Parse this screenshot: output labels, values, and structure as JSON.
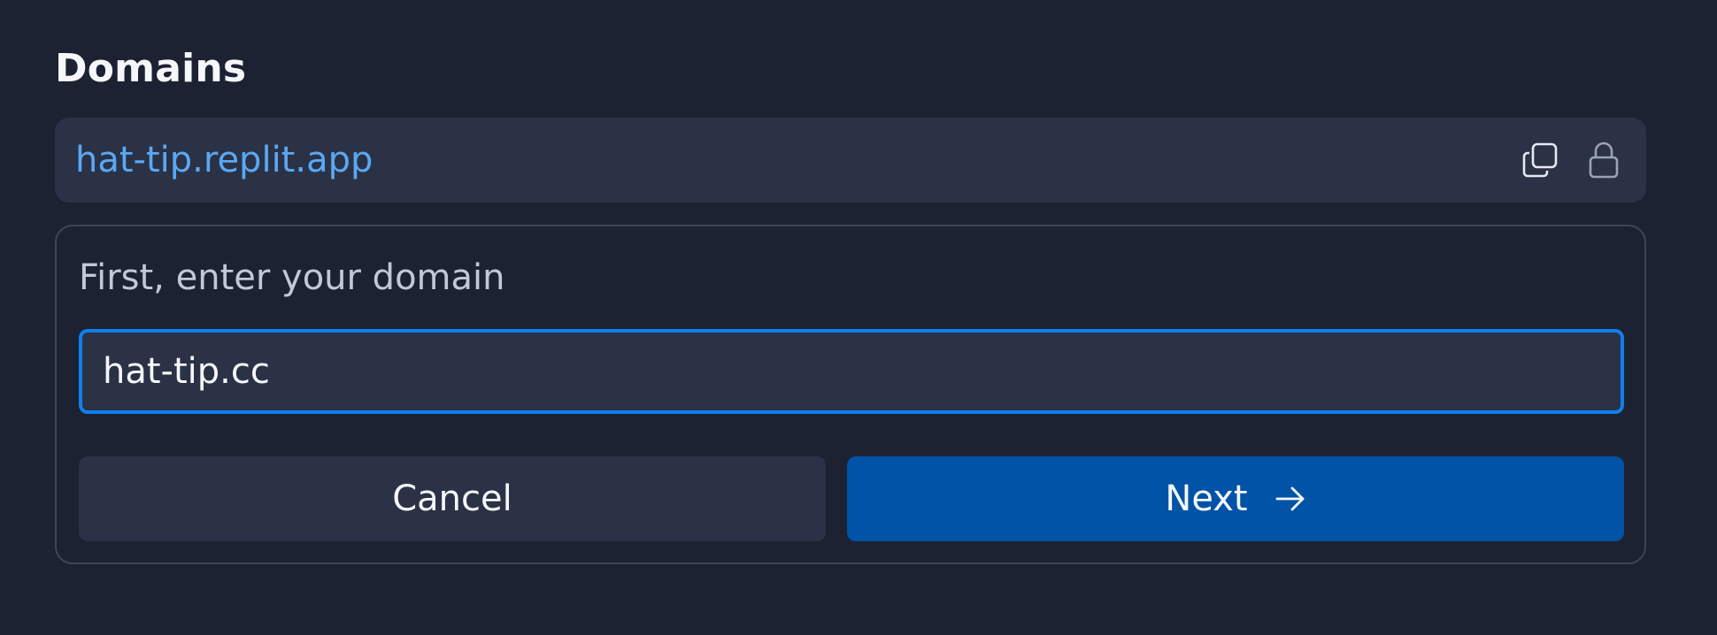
{
  "section": {
    "title": "Domains"
  },
  "current_domain": {
    "url": "hat-tip.replit.app",
    "icons": [
      "copy-icon",
      "lock-icon"
    ]
  },
  "form": {
    "label": "First, enter your domain",
    "input_value": "hat-tip.cc",
    "cancel_label": "Cancel",
    "next_label": "Next",
    "next_icon": "arrow-right-icon"
  },
  "colors": {
    "background": "#1c2232",
    "surface": "#2b3245",
    "link": "#5aa8f5",
    "focus_border": "#0f7ff0",
    "primary_button": "#0053a6"
  }
}
